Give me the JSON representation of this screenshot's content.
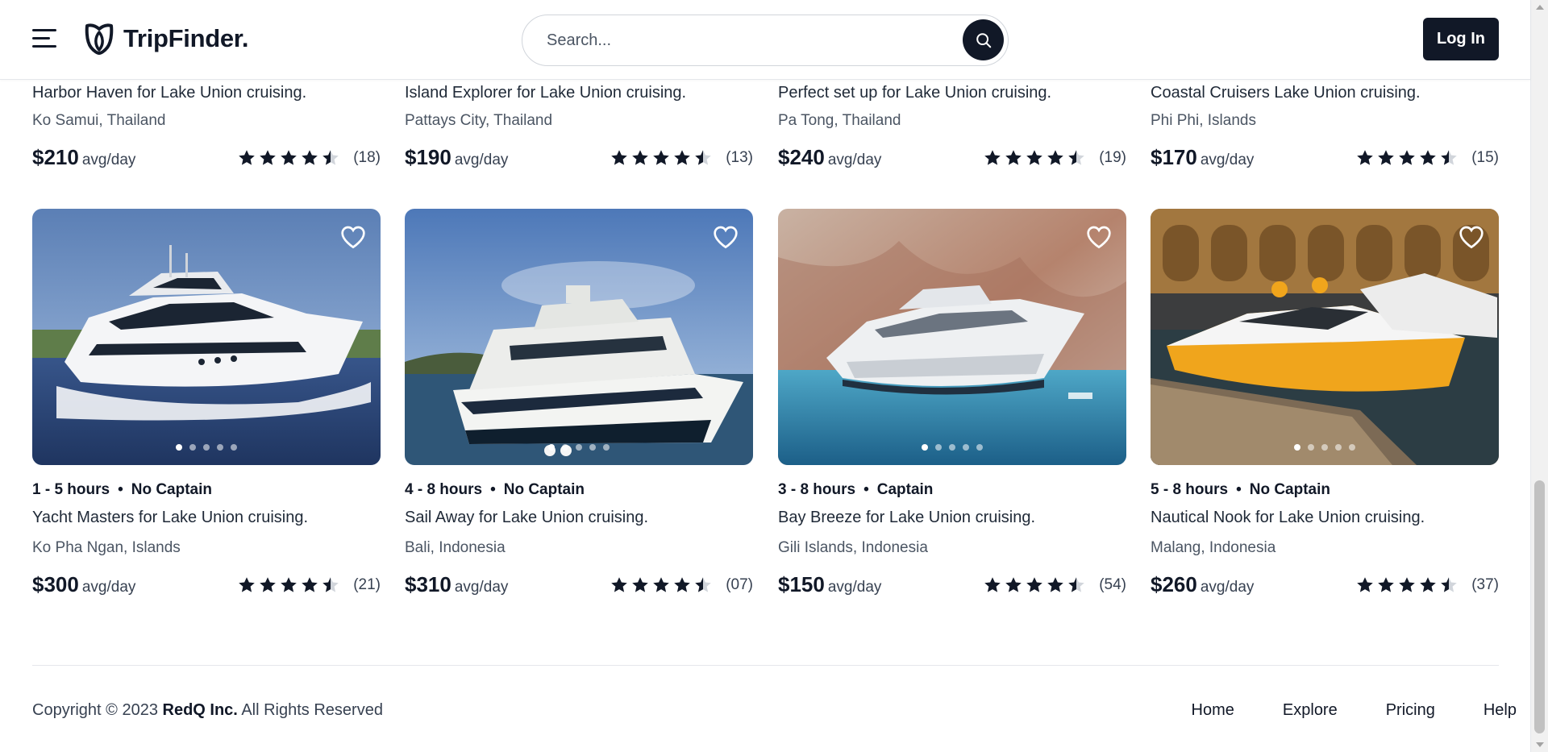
{
  "header": {
    "brand": "TripFinder.",
    "search_placeholder": "Search...",
    "login_label": "Log In"
  },
  "top_cards": [
    {
      "title": "Harbor Haven for Lake Union cruising.",
      "location": "Ko Samui, Thailand",
      "price": "$210",
      "per": "avg/day",
      "rating": 4.5,
      "count": "(18)"
    },
    {
      "title": "Island Explorer for Lake Union cruising.",
      "location": "Pattays City, Thailand",
      "price": "$190",
      "per": "avg/day",
      "rating": 4.5,
      "count": "(13)"
    },
    {
      "title": "Perfect set up for Lake Union cruising.",
      "location": "Pa Tong, Thailand",
      "price": "$240",
      "per": "avg/day",
      "rating": 4.5,
      "count": "(19)"
    },
    {
      "title": "Coastal Cruisers Lake Union cruising.",
      "location": "Phi Phi, Islands",
      "price": "$170",
      "per": "avg/day",
      "rating": 4.5,
      "count": "(15)"
    }
  ],
  "cards": [
    {
      "duration": "1 - 5 hours",
      "captain": "No Captain",
      "title": "Yacht Masters for Lake Union cruising.",
      "location": "Ko Pha Ngan, Islands",
      "price": "$300",
      "per": "avg/day",
      "rating": 4.5,
      "count": "(21)",
      "image": "white-motor-yacht"
    },
    {
      "duration": "4 - 8 hours",
      "captain": "No Captain",
      "title": "Sail Away for Lake Union cruising.",
      "location": "Bali, Indonesia",
      "price": "$310",
      "per": "avg/day",
      "rating": 4.5,
      "count": "(07)",
      "image": "ferry-catamaran"
    },
    {
      "duration": "3 - 8 hours",
      "captain": "Captain",
      "title": "Bay Breeze for Lake Union cruising.",
      "location": "Gili Islands, Indonesia",
      "price": "$150",
      "per": "avg/day",
      "rating": 4.5,
      "count": "(54)",
      "image": "yacht-by-cliff"
    },
    {
      "duration": "5 - 8 hours",
      "captain": "No Captain",
      "title": "Nautical Nook for Lake Union cruising.",
      "location": "Malang, Indonesia",
      "price": "$260",
      "per": "avg/day",
      "rating": 4.5,
      "count": "(37)",
      "image": "yellow-speedboat-dock"
    }
  ],
  "carousel_dots": 5,
  "footer": {
    "copyright_prefix": "Copyright © 2023",
    "company": "RedQ Inc.",
    "copyright_suffix": "All Rights Reserved",
    "links": [
      "Home",
      "Explore",
      "Pricing",
      "Help"
    ]
  },
  "colors": {
    "primary": "#111827",
    "muted": "#4b5563",
    "divider": "#e5e7eb"
  }
}
